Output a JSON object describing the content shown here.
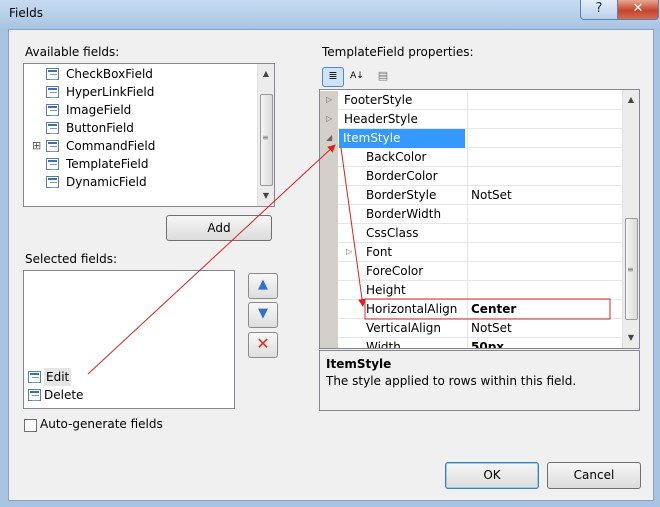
{
  "window": {
    "title": "Fields",
    "help_label": "?",
    "close_label": "✕"
  },
  "available": {
    "label": "Available fields:",
    "items": [
      {
        "label": "CheckBoxField",
        "icon": "checkbox-field-icon"
      },
      {
        "label": "HyperLinkField",
        "icon": "hyperlink-field-icon"
      },
      {
        "label": "ImageField",
        "icon": "image-field-icon"
      },
      {
        "label": "ButtonField",
        "icon": "button-field-icon"
      },
      {
        "label": "CommandField",
        "icon": "command-field-icon"
      },
      {
        "label": "TemplateField",
        "icon": "template-field-icon"
      },
      {
        "label": "DynamicField",
        "icon": "dynamic-field-icon"
      }
    ],
    "expander": "⊞",
    "add_label": "Add"
  },
  "selected": {
    "label": "Selected fields:",
    "items": [
      {
        "label": "Edit"
      },
      {
        "label": "Delete"
      }
    ],
    "up_label": "▲",
    "down_label": "▼",
    "delete_label": "✕"
  },
  "autogen": {
    "label": "Auto-generate fields",
    "checked": false
  },
  "properties": {
    "label": "TemplateField properties:",
    "toolbar": {
      "categorized_glyph": "≣",
      "alpha_glyph": "A↓",
      "pages_glyph": "▤"
    },
    "rows": [
      {
        "name": "FooterStyle",
        "value": "",
        "level": 0,
        "expander": "▷"
      },
      {
        "name": "HeaderStyle",
        "value": "",
        "level": 0,
        "expander": "▷"
      },
      {
        "name": "ItemStyle",
        "value": "",
        "level": 0,
        "expander": "◢",
        "selected": true
      },
      {
        "name": "BackColor",
        "value": "",
        "level": 1
      },
      {
        "name": "BorderColor",
        "value": "",
        "level": 1
      },
      {
        "name": "BorderStyle",
        "value": "NotSet",
        "level": 1
      },
      {
        "name": "BorderWidth",
        "value": "",
        "level": 1
      },
      {
        "name": "CssClass",
        "value": "",
        "level": 1
      },
      {
        "name": "Font",
        "value": "",
        "level": 1,
        "expander": "▷"
      },
      {
        "name": "ForeColor",
        "value": "",
        "level": 1
      },
      {
        "name": "Height",
        "value": "",
        "level": 1
      },
      {
        "name": "HorizontalAlign",
        "value": "Center",
        "level": 1,
        "bold": true,
        "highlight": true
      },
      {
        "name": "VerticalAlign",
        "value": "NotSet",
        "level": 1
      },
      {
        "name": "Width",
        "value": "50px",
        "level": 1,
        "bold": true
      }
    ],
    "description": {
      "title": "ItemStyle",
      "text": "The style applied to rows within this field."
    }
  },
  "buttons": {
    "ok_label": "OK",
    "cancel_label": "Cancel"
  },
  "colors": {
    "annotation": "#e02020",
    "selection": "#3399ff",
    "title_bg": "#b9d1ea"
  }
}
